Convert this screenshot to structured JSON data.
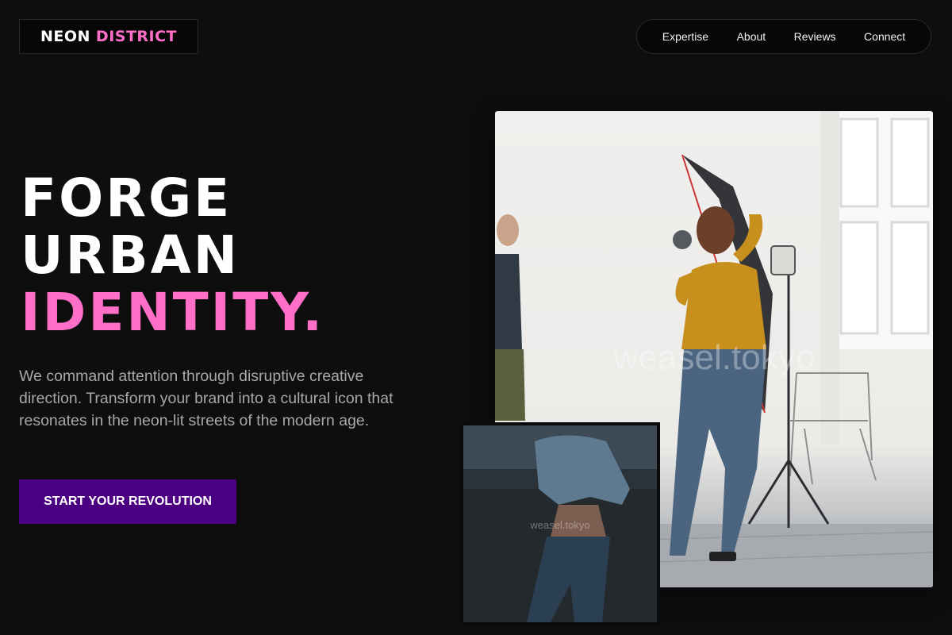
{
  "logo": {
    "word1": "NEON",
    "word2": "DISTRICT"
  },
  "nav": {
    "items": [
      "Expertise",
      "About",
      "Reviews",
      "Connect"
    ]
  },
  "hero": {
    "title_line1": "FORGE",
    "title_line2": "URBAN",
    "title_line3": "IDENTITY.",
    "description": "We command attention through disruptive creative direction. Transform your brand into a cultural icon that resonates in the neon-lit streets of the modern age.",
    "cta_label": "START YOUR REVOLUTION"
  },
  "images": {
    "main_watermark": "weasel.tokyo",
    "small_watermark": "weasel.tokyo"
  },
  "colors": {
    "background": "#0e0e0f",
    "accent_pink": "#ff6ec7",
    "cta_purple": "#4b0082",
    "body_text": "#a8a8ac"
  }
}
